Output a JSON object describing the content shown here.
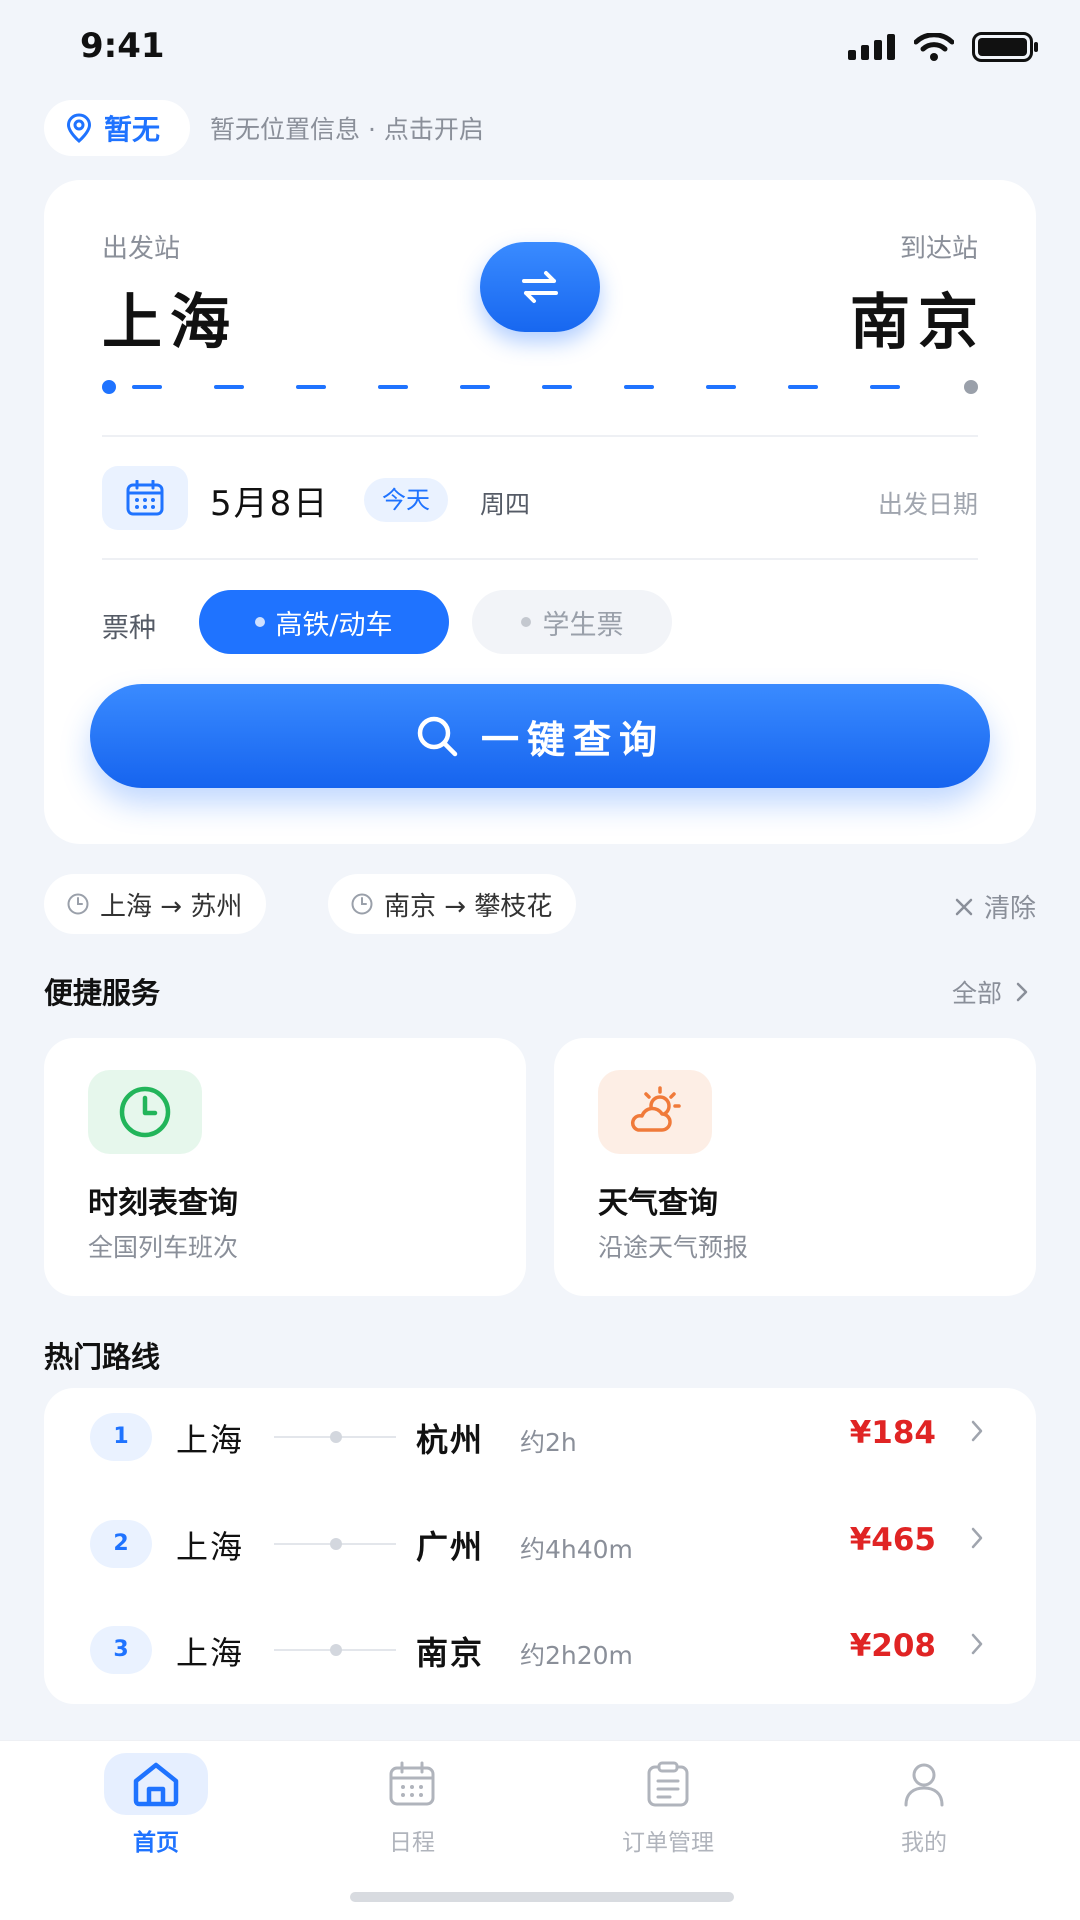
{
  "status_bar": {
    "time": "9:41"
  },
  "location": {
    "chip_label": "暂无",
    "hint": "暂无位置信息 · 点击开启"
  },
  "search": {
    "from_label": "出发站",
    "from_station": "上海",
    "to_label": "到达站",
    "to_station": "南京",
    "date": "5月8日",
    "today_tag": "今天",
    "weekday": "周四",
    "date_hint": "出发日期",
    "ticket_type_label": "票种",
    "ticket_types": [
      {
        "label": "高铁/动车",
        "selected": true
      },
      {
        "label": "学生票",
        "selected": false
      }
    ],
    "query_button": "一键查询"
  },
  "history": {
    "items": [
      {
        "label": "上海 → 苏州"
      },
      {
        "label": "南京 → 攀枝花"
      }
    ],
    "clear_label": "清除"
  },
  "services": {
    "title": "便捷服务",
    "more_label": "全部",
    "items": [
      {
        "title": "时刻表查询",
        "subtitle": "全国列车班次",
        "icon": "clock-icon",
        "color": "#22b55a"
      },
      {
        "title": "天气查询",
        "subtitle": "沿途天气预报",
        "icon": "weather-icon",
        "color": "#f07a3a"
      }
    ]
  },
  "hot_routes": {
    "title": "热门路线",
    "items": [
      {
        "rank": "1",
        "from": "上海",
        "to": "杭州",
        "duration": "约2h",
        "price": "¥184"
      },
      {
        "rank": "2",
        "from": "上海",
        "to": "广州",
        "duration": "约4h40m",
        "price": "¥465"
      },
      {
        "rank": "3",
        "from": "上海",
        "to": "南京",
        "duration": "约2h20m",
        "price": "¥208"
      }
    ]
  },
  "tabbar": {
    "items": [
      {
        "label": "首页",
        "icon": "home-icon",
        "active": true
      },
      {
        "label": "日程",
        "icon": "calendar-icon",
        "active": false
      },
      {
        "label": "订单管理",
        "icon": "clipboard-icon",
        "active": false
      },
      {
        "label": "我的",
        "icon": "user-icon",
        "active": false
      }
    ]
  },
  "colors": {
    "accent": "#1f73ff",
    "price": "#e02424",
    "background": "#f2f5fa"
  }
}
